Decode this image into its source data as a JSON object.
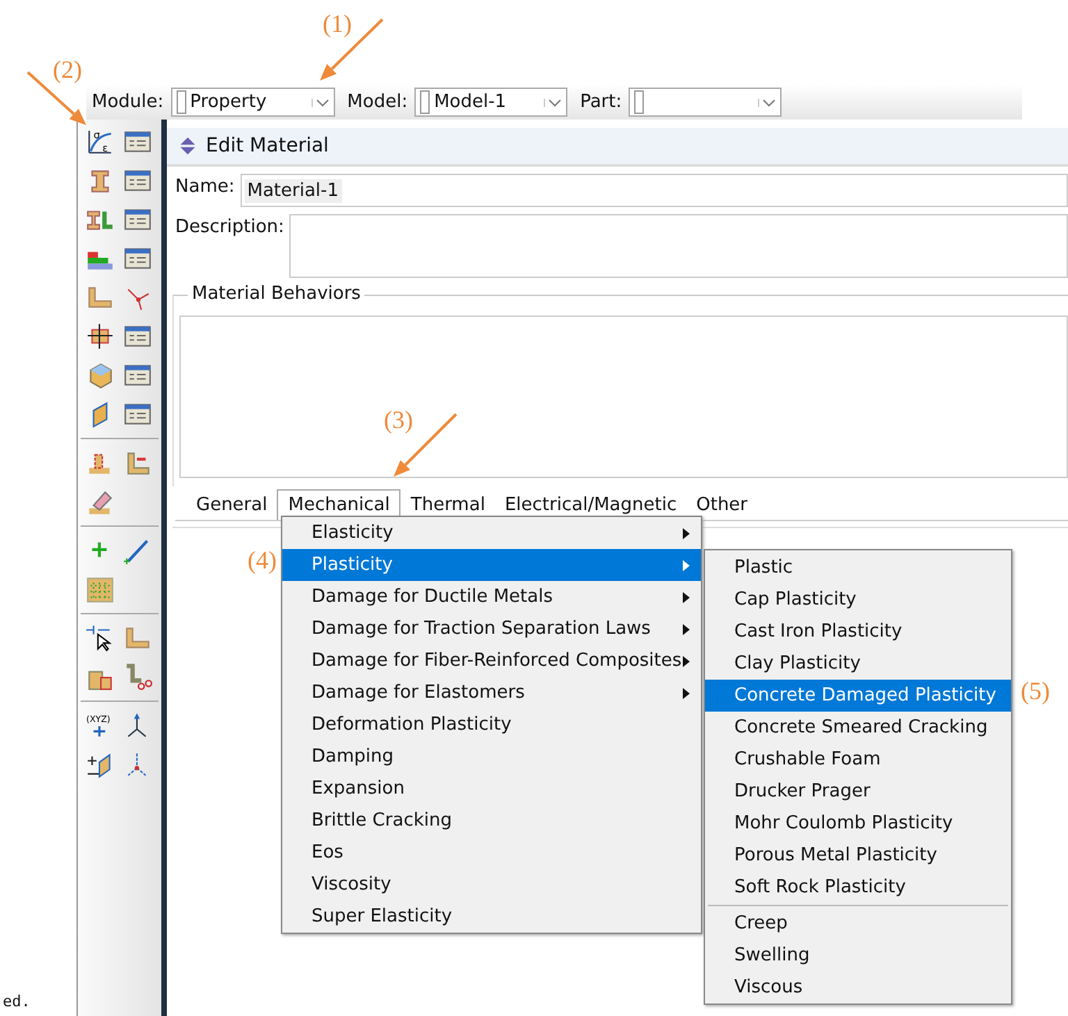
{
  "annotations": [
    {
      "label": "(1)"
    },
    {
      "label": "(2)"
    },
    {
      "label": "(3)"
    },
    {
      "label": "(4)"
    },
    {
      "label": "(5)"
    }
  ],
  "toolbar": {
    "fields": [
      {
        "label": "Module:",
        "value": "Property"
      },
      {
        "label": "Model:",
        "value": "Model-1"
      },
      {
        "label": "Part:"
      }
    ]
  },
  "toolbox": {
    "stress_symbol": "σ",
    "strain_symbol": "ε",
    "point_label": "(XYZ)"
  },
  "console_text": "ed.",
  "dialog": {
    "title": "Edit Material",
    "name_label": "Name:",
    "name_value": "Material-1",
    "description_label": "Description:",
    "behaviors_label": "Material Behaviors",
    "tabs": [
      {
        "label": "General",
        "selected": false
      },
      {
        "label": "Mechanical",
        "selected": true
      },
      {
        "label": "Thermal",
        "selected": false
      },
      {
        "label": "Electrical/Magnetic",
        "selected": false
      },
      {
        "label": "Other",
        "selected": false
      }
    ]
  },
  "menu": {
    "items": [
      {
        "label": "Elasticity",
        "has_submenu": true,
        "selected": false
      },
      {
        "label": "Plasticity",
        "has_submenu": true,
        "selected": true
      },
      {
        "label": "Damage for Ductile Metals",
        "has_submenu": true,
        "selected": false
      },
      {
        "label": "Damage for Traction Separation Laws",
        "has_submenu": true,
        "selected": false
      },
      {
        "label": "Damage for Fiber-Reinforced Composites",
        "has_submenu": true,
        "selected": false
      },
      {
        "label": "Damage for Elastomers",
        "has_submenu": true,
        "selected": false
      },
      {
        "label": "Deformation Plasticity",
        "has_submenu": false,
        "selected": false
      },
      {
        "label": "Damping",
        "has_submenu": false,
        "selected": false
      },
      {
        "label": "Expansion",
        "has_submenu": false,
        "selected": false
      },
      {
        "label": "Brittle Cracking",
        "has_submenu": false,
        "selected": false
      },
      {
        "label": "Eos",
        "has_submenu": false,
        "selected": false
      },
      {
        "label": "Viscosity",
        "has_submenu": false,
        "selected": false
      },
      {
        "label": "Super Elasticity",
        "has_submenu": false,
        "selected": false
      }
    ]
  },
  "submenu": {
    "sections": [
      [
        {
          "label": "Plastic",
          "selected": false
        },
        {
          "label": "Cap Plasticity",
          "selected": false
        },
        {
          "label": "Cast Iron Plasticity",
          "selected": false
        },
        {
          "label": "Clay Plasticity",
          "selected": false
        },
        {
          "label": "Concrete Damaged Plasticity",
          "selected": true
        },
        {
          "label": "Concrete Smeared Cracking",
          "selected": false
        },
        {
          "label": "Crushable Foam",
          "selected": false
        },
        {
          "label": "Drucker Prager",
          "selected": false
        },
        {
          "label": "Mohr Coulomb Plasticity",
          "selected": false
        },
        {
          "label": "Porous Metal Plasticity",
          "selected": false
        },
        {
          "label": "Soft Rock Plasticity",
          "selected": false
        }
      ],
      [
        {
          "label": "Creep",
          "selected": false
        },
        {
          "label": "Swelling",
          "selected": false
        },
        {
          "label": "Viscous",
          "selected": false
        }
      ]
    ]
  }
}
